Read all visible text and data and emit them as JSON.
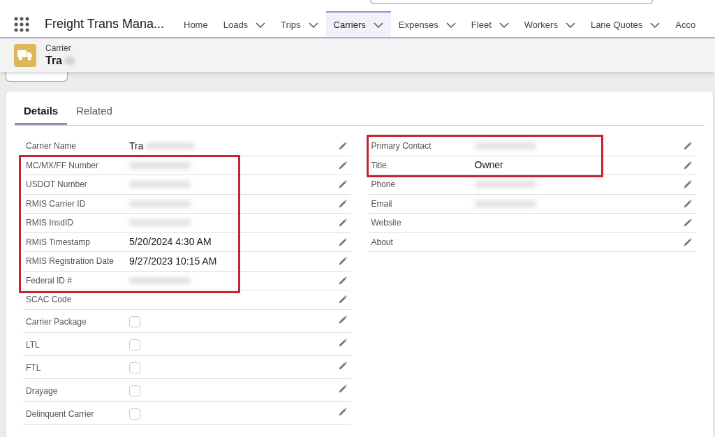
{
  "app": {
    "title": "Freight Trans Mana..."
  },
  "nav": [
    {
      "label": "Home",
      "dropdown": false,
      "selected": false
    },
    {
      "label": "Loads",
      "dropdown": true,
      "selected": false
    },
    {
      "label": "Trips",
      "dropdown": true,
      "selected": false
    },
    {
      "label": "Carriers",
      "dropdown": true,
      "selected": true
    },
    {
      "label": "Expenses",
      "dropdown": true,
      "selected": false
    },
    {
      "label": "Fleet",
      "dropdown": true,
      "selected": false
    },
    {
      "label": "Workers",
      "dropdown": true,
      "selected": false
    },
    {
      "label": "Lane Quotes",
      "dropdown": true,
      "selected": false
    },
    {
      "label": "Acco",
      "dropdown": false,
      "selected": false
    }
  ],
  "record": {
    "type": "Carrier",
    "name": "Tra",
    "redacted": true
  },
  "tabs": [
    {
      "label": "Details",
      "selected": true
    },
    {
      "label": "Related",
      "selected": false
    }
  ],
  "columns": [
    {
      "groups": [
        {
          "highlighted": false,
          "fields": [
            {
              "label": "Carrier Name",
              "kind": "text",
              "value": "Tra",
              "redacted": true
            }
          ]
        },
        {
          "highlighted": true,
          "fields": [
            {
              "label": "MC/MX/FF Number",
              "kind": "text",
              "redacted": true
            },
            {
              "label": "USDOT Number",
              "kind": "text",
              "redacted": true
            },
            {
              "label": "RMIS Carrier ID",
              "kind": "text",
              "redacted": true
            },
            {
              "label": "RMIS InsdID",
              "kind": "text",
              "redacted": true
            },
            {
              "label": "RMIS Timestamp",
              "kind": "text",
              "value": "5/20/2024 4:30 AM",
              "redacted": false
            },
            {
              "label": "RMIS Registration Date",
              "kind": "text",
              "value": "9/27/2023 10:15 AM",
              "redacted": false
            },
            {
              "label": "Federal ID #",
              "kind": "text",
              "redacted": true
            }
          ]
        },
        {
          "highlighted": false,
          "fields": [
            {
              "label": "SCAC Code",
              "kind": "text",
              "redacted": false
            },
            {
              "label": "Carrier Package",
              "kind": "checkbox",
              "checked": false
            },
            {
              "label": "LTL",
              "kind": "checkbox",
              "checked": false
            },
            {
              "label": "FTL",
              "kind": "checkbox",
              "checked": false
            },
            {
              "label": "Drayage",
              "kind": "checkbox",
              "checked": false
            },
            {
              "label": "Delinquent Carrier",
              "kind": "checkbox",
              "checked": false
            }
          ]
        }
      ]
    },
    {
      "groups": [
        {
          "highlighted": true,
          "fields": [
            {
              "label": "Primary Contact",
              "kind": "text",
              "redacted": true
            },
            {
              "label": "Title",
              "kind": "text",
              "value": "Owner",
              "redacted": false
            }
          ]
        },
        {
          "highlighted": false,
          "fields": [
            {
              "label": "Phone",
              "kind": "text",
              "redacted": true
            },
            {
              "label": "Email",
              "kind": "text",
              "redacted": true
            },
            {
              "label": "Website",
              "kind": "text",
              "redacted": false
            },
            {
              "label": "About",
              "kind": "text",
              "redacted": false
            }
          ]
        }
      ]
    }
  ]
}
